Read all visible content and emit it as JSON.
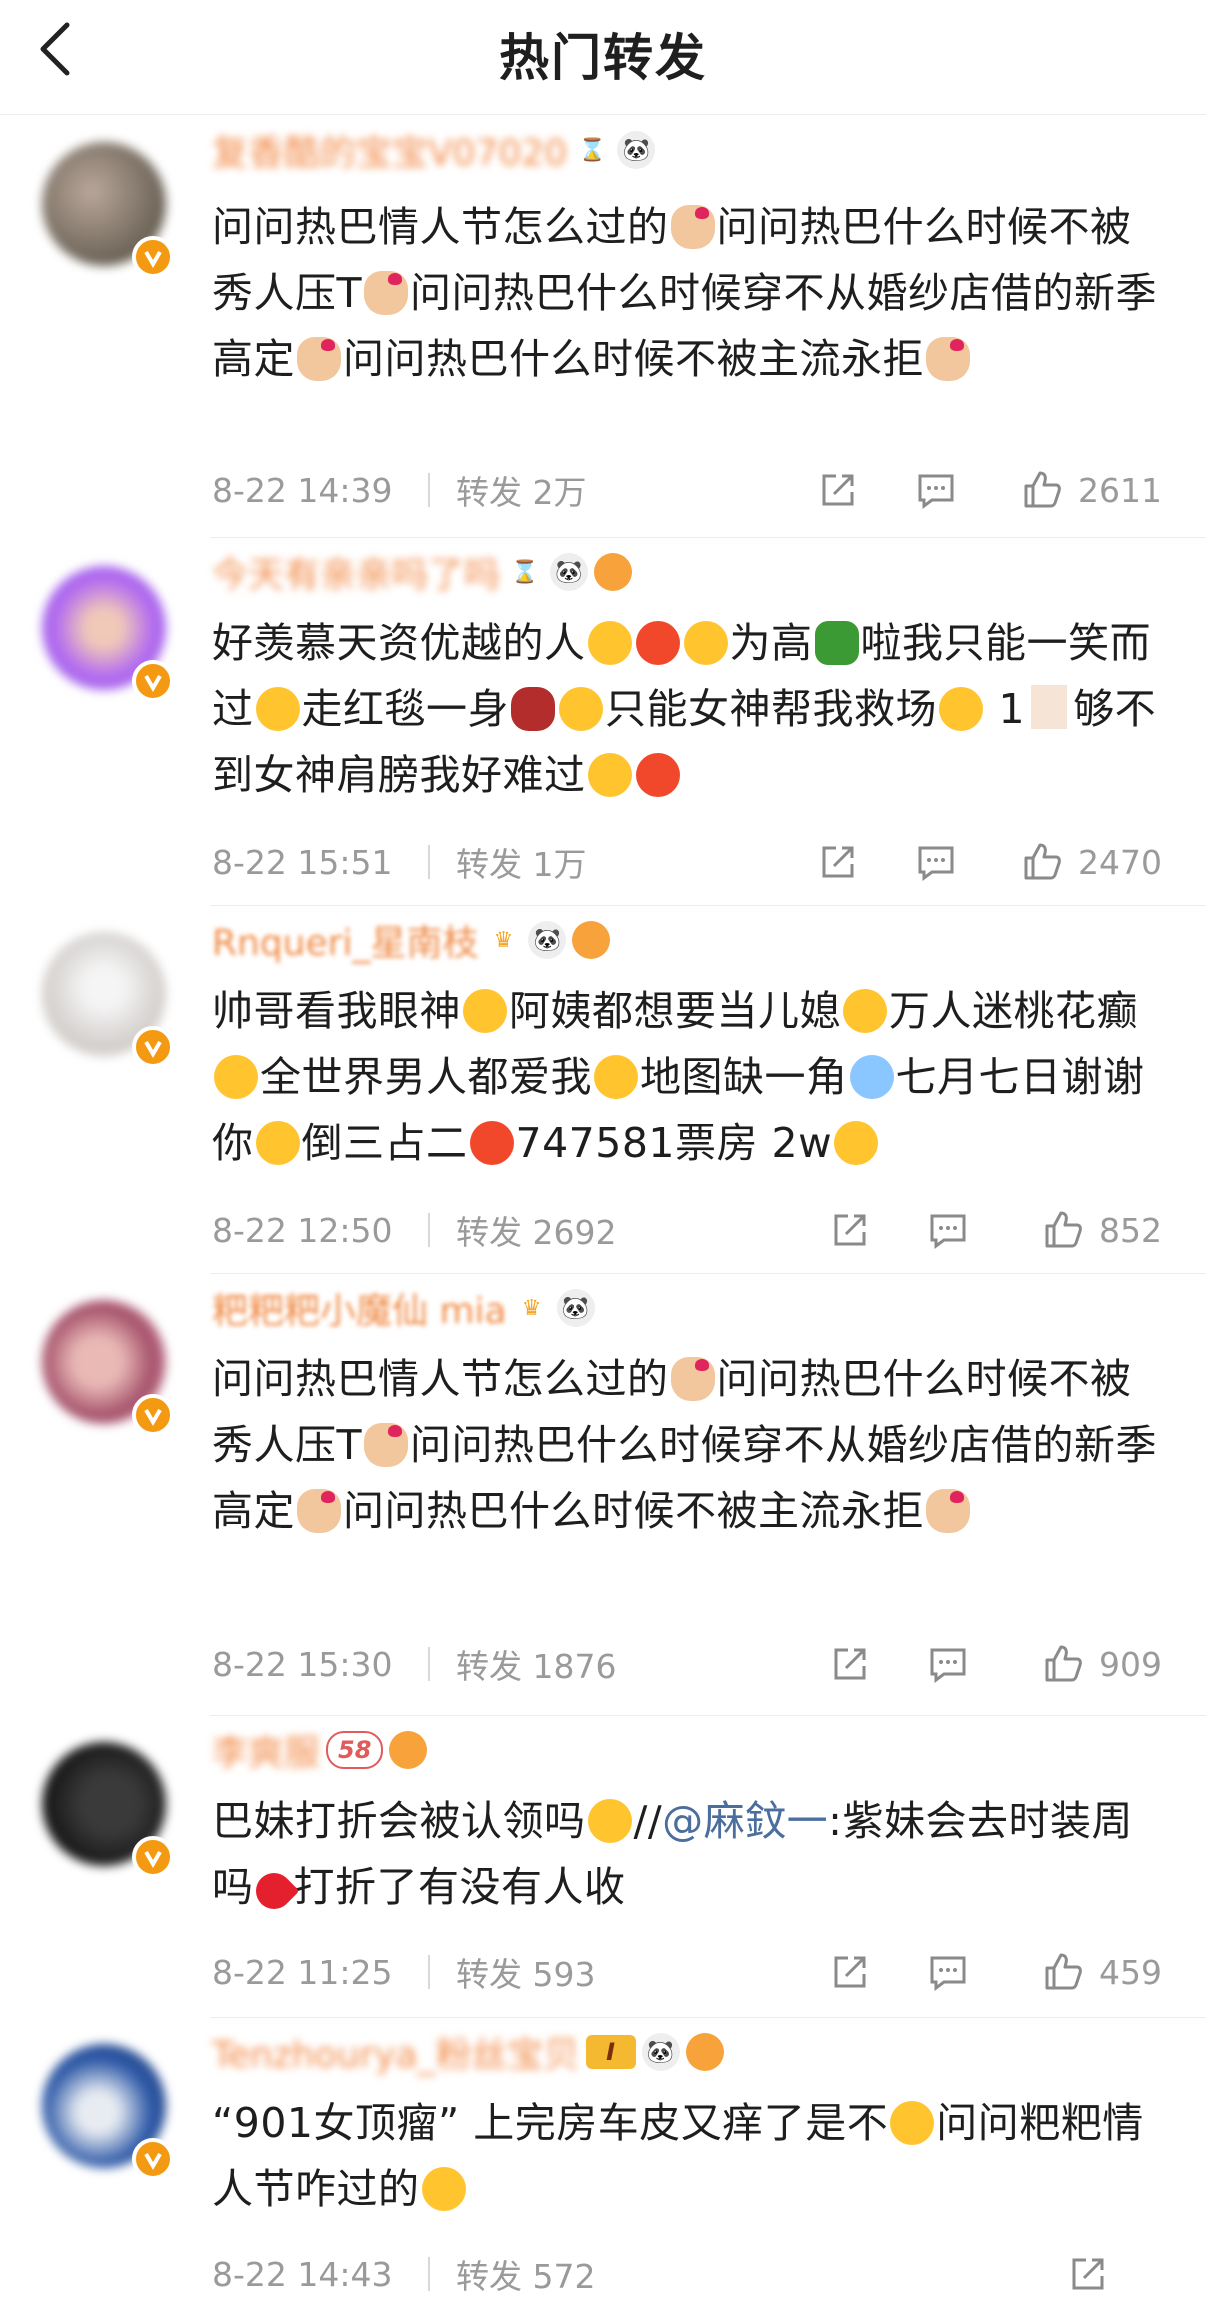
{
  "header": {
    "title": "热门转发"
  },
  "posts": [
    {
      "username": "复香酷的宝宝V07020",
      "text": [
        "问问热巴情人节怎么过的",
        "问问热巴什么时候不被秀人压T",
        "问问热巴什么时候穿不从婚纱店借的新季高定",
        "问问热巴什么时候不被主流永拒"
      ],
      "time": "8-22 14:39",
      "forward": "转发 2万",
      "likes": "2611"
    },
    {
      "username": "今天有亲亲吗了吗",
      "text": [
        "好羡慕天资优越的人",
        "为高",
        "啦我只能一笑而过",
        "走红毯一身",
        "只能女神帮我救场",
        "1",
        "够不到女神肩膀我好难过"
      ],
      "time": "8-22 15:51",
      "forward": "转发 1万",
      "likes": "2470"
    },
    {
      "username": "Rnqueri_星南枝",
      "text": [
        "帅哥看我眼神",
        "阿姨都想要当儿媳",
        "万人迷桃花癫",
        "全世界男人都爱我",
        "地图缺一角",
        "七月七日谢谢你",
        "倒三占二",
        "747581票房 2w"
      ],
      "time": "8-22 12:50",
      "forward": "转发 2692",
      "likes": "852"
    },
    {
      "username": "粑粑粑小魔仙 mia",
      "text": [
        "问问热巴情人节怎么过的",
        "问问热巴什么时候不被秀人压T",
        "问问热巴什么时候穿不从婚纱店借的新季高定",
        "问问热巴什么时候不被主流永拒"
      ],
      "time": "8-22 15:30",
      "forward": "转发 1876",
      "likes": "909"
    },
    {
      "username": "李爽服",
      "level": "58",
      "text": [
        "巴妹打折会被认领吗",
        "//",
        "@麻鈫一",
        ":紫妹会去时装周吗",
        "打折了有没有人收"
      ],
      "time": "8-22 11:25",
      "forward": "转发 593",
      "likes": "459"
    },
    {
      "username": "Tenzhourya_粉丝宝贝",
      "level": "I",
      "text": [
        "“901女顶瘤” 上完房车皮又痒了是不",
        "问问粑粑情人节咋过的"
      ],
      "time": "8-22 14:43",
      "forward": "转发 572",
      "likes": ""
    }
  ]
}
